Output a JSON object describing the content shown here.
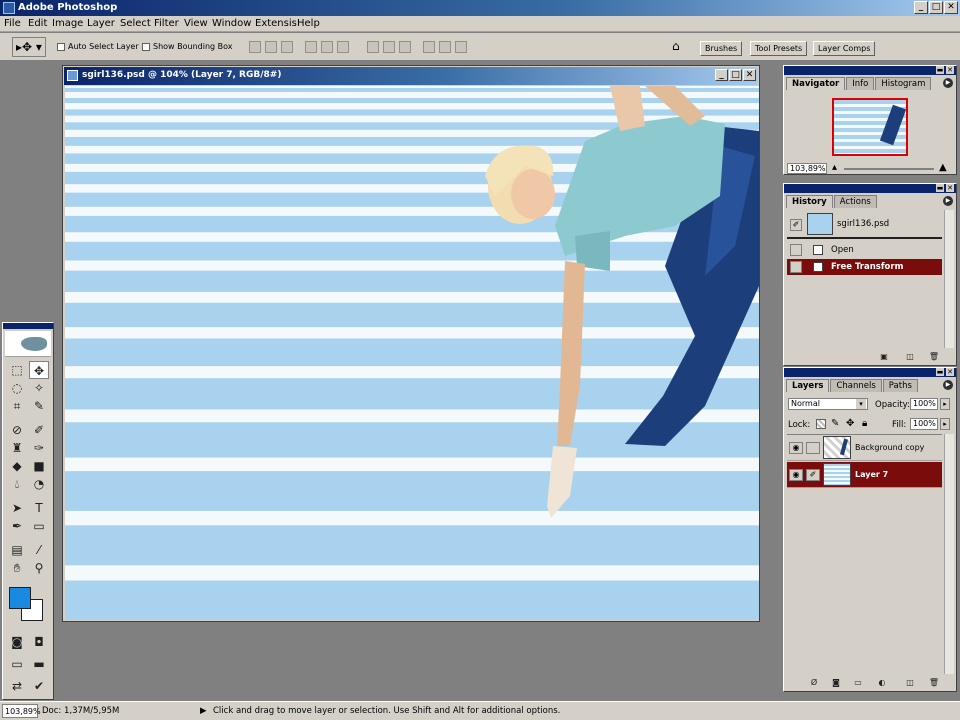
{
  "app": {
    "title": "Adobe Photoshop"
  },
  "window_controls": {
    "minimize": "_",
    "maximize": "□",
    "close": "✕"
  },
  "menu": [
    "File",
    "Edit",
    "Image",
    "Layer",
    "Select",
    "Filter",
    "View",
    "Window",
    "Extensis",
    "Help"
  ],
  "options": {
    "auto_select_label": "Auto Select Layer",
    "bounding_box_label": "Show Bounding Box"
  },
  "palette_well": [
    "Brushes",
    "Tool Presets",
    "Layer Comps"
  ],
  "document": {
    "title": "sgirl136.psd @ 104% (Layer 7, RGB/8#)"
  },
  "navigator": {
    "tabs": [
      "Navigator",
      "Info",
      "Histogram"
    ],
    "zoom": "103,89%"
  },
  "history": {
    "tabs": [
      "History",
      "Actions"
    ],
    "snapshot": "sgirl136.psd",
    "items": [
      "Open",
      "Free Transform"
    ],
    "selected_index": 1
  },
  "layers": {
    "tabs": [
      "Layers",
      "Channels",
      "Paths"
    ],
    "blend_mode": "Normal",
    "opacity_label": "Opacity:",
    "opacity": "100%",
    "lock_label": "Lock:",
    "fill_label": "Fill:",
    "fill": "100%",
    "items": [
      {
        "name": "Background copy",
        "selected": false
      },
      {
        "name": "Layer 7",
        "selected": true
      }
    ]
  },
  "status": {
    "zoom": "103,89%",
    "doc": "Doc: 1,37M/5,95M",
    "message": "Click and drag to move layer or selection.  Use Shift and Alt for additional options."
  },
  "colors": {
    "foreground": "#1a8ae0",
    "background": "#ffffff",
    "stripe_blue": "#a8d2ee",
    "stripe_white": "#f4f9fc",
    "selection": "#7a0c0c",
    "titlebar": "#0a246a"
  }
}
